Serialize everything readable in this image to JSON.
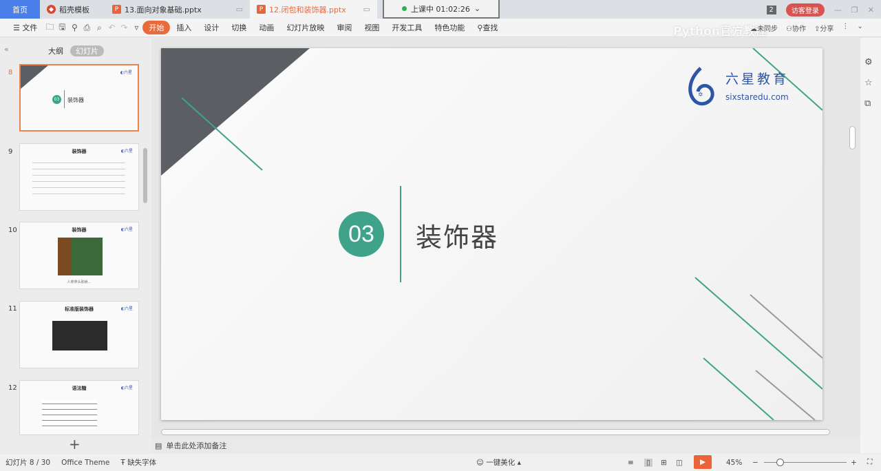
{
  "tabs": {
    "home": "首页",
    "templates": "稻壳模板",
    "doc1": "13.面向对象基础.pptx",
    "doc2": "12.闭包和装饰器.pptx"
  },
  "timer": "上课中 01:02:26",
  "window": {
    "badge": "2",
    "login": "访客登录"
  },
  "toolbar": {
    "file": "文件",
    "items": [
      "开始",
      "插入",
      "设计",
      "切换",
      "动画",
      "幻灯片放映",
      "审阅",
      "视图",
      "开发工具",
      "特色功能"
    ],
    "search": "查找",
    "right": [
      "未同步",
      "协作",
      "分享"
    ],
    "watermark": "Python官方教程"
  },
  "left_panel": {
    "tab_outline": "大纲",
    "tab_slides": "幻灯片",
    "add": "+"
  },
  "thumbnails": [
    {
      "num": "8",
      "title": "装饰器",
      "badge": "03"
    },
    {
      "num": "9",
      "title": "装饰器"
    },
    {
      "num": "10",
      "title": "装饰器",
      "caption": "人拿斧头砍树…"
    },
    {
      "num": "11",
      "title": "标准版装饰器"
    },
    {
      "num": "12",
      "title": "语法糖"
    }
  ],
  "slide": {
    "number": "03",
    "title": "装饰器",
    "logo_name": "六星教育",
    "logo_url": "sixstaredu.com",
    "colors": {
      "accent": "#3fa38a",
      "dark": "#5b5e63"
    }
  },
  "notes": "单击此处添加备注",
  "status": {
    "slide": "幻灯片 8 / 30",
    "theme": "Office Theme",
    "font": "缺失字体",
    "beautify": "一键美化",
    "zoom": "45%"
  }
}
